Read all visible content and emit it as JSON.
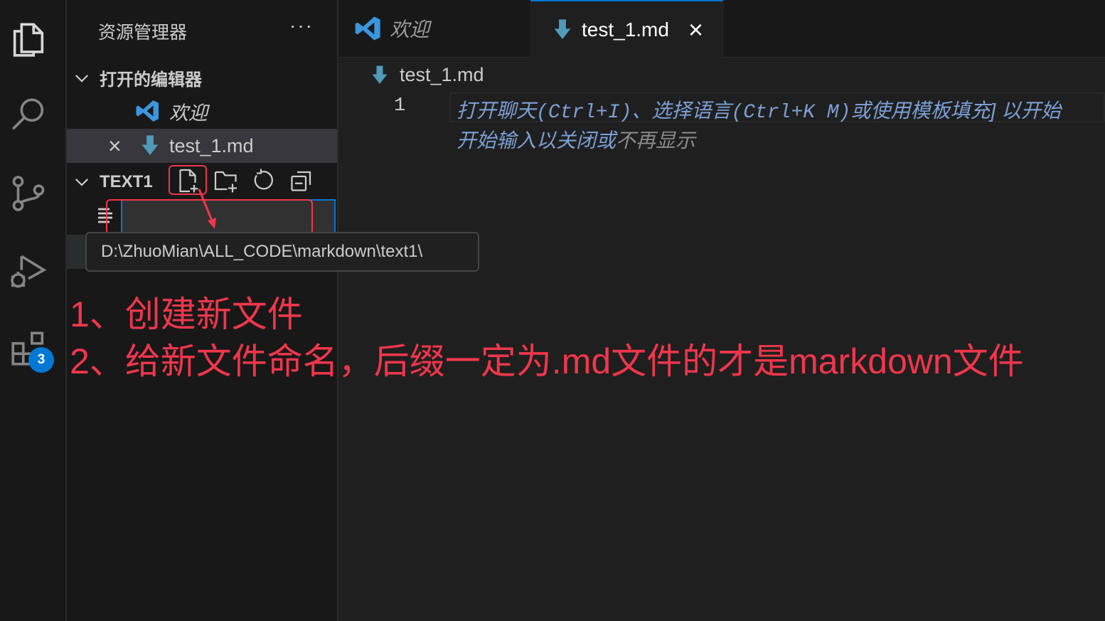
{
  "colors": {
    "accent": "#0078d4",
    "annotation": "#f0364c",
    "markdown_icon": "#519aba",
    "vscode_logo": "#3a96dd"
  },
  "activity_bar": {
    "items": [
      {
        "name": "explorer-icon"
      },
      {
        "name": "search-icon"
      },
      {
        "name": "source-control-icon"
      },
      {
        "name": "run-debug-icon"
      },
      {
        "name": "extensions-icon"
      }
    ],
    "extensions_badge": "3"
  },
  "sidebar": {
    "title": "资源管理器",
    "more": "···",
    "open_editors": {
      "label": "打开的编辑器",
      "items": [
        {
          "label": "欢迎",
          "icon": "vscode-logo-icon"
        },
        {
          "label": "test_1.md",
          "icon": "markdown-icon",
          "close": "×"
        }
      ]
    },
    "folder": {
      "label": "TEXT1",
      "actions": [
        "new-file-icon",
        "new-folder-icon",
        "refresh-icon",
        "collapse-all-icon"
      ],
      "new_file_input": "",
      "tooltip": "D:\\ZhuoMian\\ALL_CODE\\markdown\\text1\\"
    }
  },
  "tabs": [
    {
      "label": "欢迎",
      "icon": "vscode-logo-icon",
      "active": false
    },
    {
      "label": "test_1.md",
      "icon": "markdown-icon",
      "active": true,
      "close": "×"
    }
  ],
  "editor": {
    "breadcrumb": "test_1.md",
    "line_number": "1",
    "hint_line1": {
      "p1": "打开聊天",
      "p2": "(Ctrl+I)",
      "p3": "、选择语言",
      "p4": "(Ctrl+K M)",
      "p5": "或使用模板填充] 以开始"
    },
    "hint_line2": {
      "p1": "开始输入以关闭或",
      "p2": "不再显示"
    }
  },
  "annotations": {
    "step1": "1、创建新文件",
    "step2": "2、给新文件命名，后缀一定为.md文件的才是markdown文件"
  }
}
